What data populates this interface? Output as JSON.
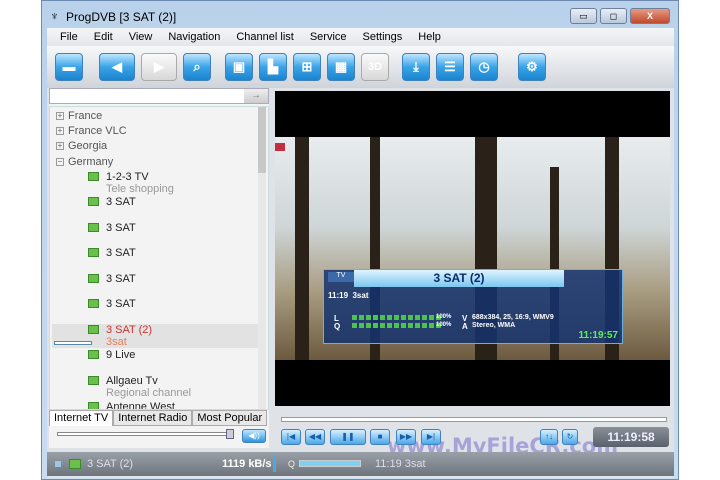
{
  "window": {
    "title": "ProgDVB [3 SAT (2)]",
    "minimize": "▭",
    "maximize": "◻",
    "close": "X"
  },
  "menu": [
    "File",
    "Edit",
    "View",
    "Navigation",
    "Channel list",
    "Service",
    "Settings",
    "Help"
  ],
  "toolbar": [
    {
      "name": "open-folder",
      "glyph": "▬"
    },
    {
      "name": "back",
      "glyph": "◀"
    },
    {
      "name": "forward",
      "glyph": "▶"
    },
    {
      "name": "search",
      "glyph": "⌕"
    },
    {
      "name": "window-mode",
      "glyph": "▣"
    },
    {
      "name": "corner-mode",
      "glyph": "▙"
    },
    {
      "name": "grid-4",
      "glyph": "⊞"
    },
    {
      "name": "grid-many",
      "glyph": "▦"
    },
    {
      "name": "3d",
      "glyph": "3D"
    },
    {
      "name": "record",
      "glyph": "⤓"
    },
    {
      "name": "list",
      "glyph": "☰"
    },
    {
      "name": "scheduler",
      "glyph": "◷"
    },
    {
      "name": "settings",
      "glyph": "⚙"
    }
  ],
  "search": {
    "value": "",
    "go": "→"
  },
  "tree": {
    "groups": [
      {
        "label": "France",
        "sign": "+"
      },
      {
        "label": "France VLC",
        "sign": "+"
      },
      {
        "label": "Georgia",
        "sign": "+"
      },
      {
        "label": "Germany",
        "sign": "−"
      }
    ],
    "channels": [
      {
        "name": "1-2-3 TV",
        "sub": "Tele shopping"
      },
      {
        "name": "3 SAT",
        "sub": ""
      },
      {
        "name": "3 SAT",
        "sub": ""
      },
      {
        "name": "3 SAT",
        "sub": ""
      },
      {
        "name": "3 SAT",
        "sub": ""
      },
      {
        "name": "3 SAT",
        "sub": ""
      },
      {
        "name": "3 SAT (2)",
        "sub": "3sat"
      },
      {
        "name": "9 Live",
        "sub": ""
      },
      {
        "name": "Allgaeu Tv",
        "sub": "Regional channel"
      },
      {
        "name": "Antenne West",
        "sub": ""
      }
    ]
  },
  "tabs": [
    "Internet TV",
    "Internet Radio",
    "Most Popular"
  ],
  "osd": {
    "type": "TV",
    "channel": "3 SAT (2)",
    "time": "11:19",
    "program": "3sat",
    "l": "L",
    "q": "Q",
    "level": "100%",
    "quality": "100%",
    "v": "V",
    "a": "A",
    "video": "688x384, 25, 16:9, WMV9",
    "audio": "Stereo, WMA",
    "clock": "11:19:57"
  },
  "player": {
    "clock": "11:19:58",
    "buttons": [
      "|◀",
      "◀◀",
      "❚❚",
      "■",
      "▶▶",
      "▶|"
    ],
    "watermark": "www.MyFileCR.com"
  },
  "status": {
    "channel": "3 SAT (2)",
    "rate": "1119 kB/s",
    "q": "Q",
    "epg": "11:19 3sat"
  }
}
